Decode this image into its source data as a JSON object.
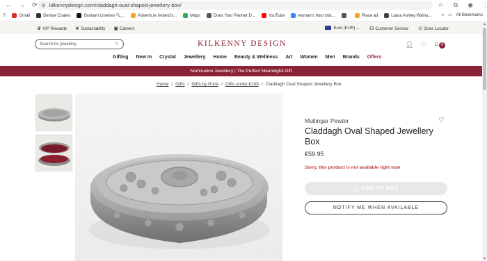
{
  "browser": {
    "url": "kilkennydesign.com/claddagh-oval-shaped-jewellery-box/",
    "bookmarks": [
      {
        "label": "Gmail",
        "color": "#d93025"
      },
      {
        "label": "Denise Coates",
        "color": "#333333"
      },
      {
        "label": "Graham Linehan 🔍...",
        "color": "#111111"
      },
      {
        "label": "Adverts.ie Ireland's...",
        "color": "#f5a623"
      },
      {
        "label": "Maps",
        "color": "#34a853"
      },
      {
        "label": "Does Your Partner D...",
        "color": "#555555"
      },
      {
        "label": "YouTube",
        "color": "#ff0000"
      },
      {
        "label": "woman's hour bbc...",
        "color": "#4285f4"
      },
      {
        "label": "",
        "color": "#555555"
      },
      {
        "label": "Place ad",
        "color": "#f5a623"
      },
      {
        "label": "Laura Ashley Walnu...",
        "color": "#444444"
      }
    ],
    "all_bookmarks": "All Bookmarks"
  },
  "utility": {
    "vip": "VIP Rewards",
    "sustainability": "Sustainability",
    "careers": "Careers",
    "currency": "Euro (EUR)",
    "customer_service": "Customer Service",
    "store_locator": "Store Locator"
  },
  "header": {
    "logo": "KILKENNY DESIGN",
    "search_placeholder": "Search for jewellery",
    "cart_count": "0",
    "nav": [
      "Gifting",
      "New In",
      "Crystal",
      "Jewellery",
      "Home",
      "Beauty & Wellness",
      "Art",
      "Women",
      "Men",
      "Brands",
      "Offers"
    ]
  },
  "promo": "Nomination Jewellery | The Perfect Meaningful Gift",
  "breadcrumb": [
    "Home",
    "Gifts",
    "Gifts by Price",
    "Gifts under €100",
    "Claddagh Oval Shaped Jewellery Box"
  ],
  "product": {
    "brand": "Mullingar Pewter",
    "title": "Claddagh Oval Shaped Jewellery Box",
    "price": "€59.95",
    "availability": "Sorry, this product is not available right now",
    "add_to_bag": "ADD TO BAG",
    "notify": "NOTIFY ME WHEN AVAILABLE"
  },
  "colors": {
    "brand": "#8b2336",
    "error": "#c13a3a"
  }
}
